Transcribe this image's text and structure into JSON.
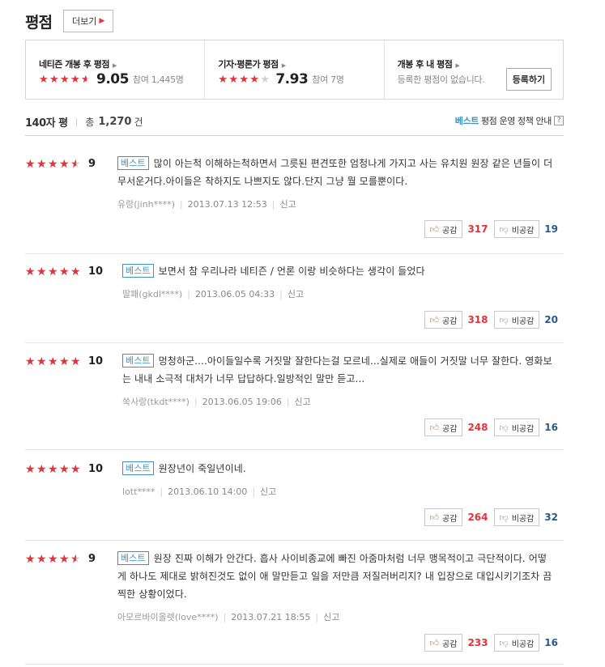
{
  "header": {
    "title": "평점",
    "more_label": "더보기"
  },
  "summary_box": {
    "netizen": {
      "label": "네티즌 개봉 후 평점",
      "rating": 9.05,
      "score": "9.05",
      "participants": "참여 1,445명"
    },
    "critic": {
      "label": "기자·평론가 평점",
      "rating": 7.93,
      "score": "7.93",
      "participants": "참여 7명"
    },
    "mine": {
      "label": "개봉 후 내 평점",
      "none_text": "등록한 평점이 없습니다.",
      "register_label": "등록하기"
    }
  },
  "summary": {
    "title": "140자 평",
    "total_label": "총",
    "total_count": "1,270",
    "total_unit": "건",
    "policy_best": "베스트",
    "policy_text": "평점 운영 정책 안내",
    "help_label": "?"
  },
  "badge_label": "베스트",
  "vote_labels": {
    "like": "공감",
    "dislike": "비공감"
  },
  "report_label": "신고",
  "reviews": [
    {
      "rating": 9,
      "score": "9",
      "text": "많이 아는척 이해하는척하면서 그릇된 편견또한 엄청나게 가지고 사는 유치원 원장 같은 년들이 더 무서운거다.아이들은 착하지도 나쁘지도 않다.단지 그냥 뭘 모를뿐이다.",
      "author": "유랑(jinh****)",
      "date": "2013.07.13 12:53",
      "likes": "317",
      "dislikes": "19"
    },
    {
      "rating": 10,
      "score": "10",
      "text": "보면서 참 우리나라 네티즌 / 언론 이랑 비슷하다는 생각이 들었다",
      "author": "딸패(gkdl****)",
      "date": "2013.06.05 04:33",
      "likes": "318",
      "dislikes": "20"
    },
    {
      "rating": 10,
      "score": "10",
      "text": "멍청하군....아이들일수록 거짓말 잘한다는걸 모르네...실제로 애들이 거짓말 너무 잘한다. 영화보는 내내 소극적 대처가 너무 답답하다.일방적인 말만 듣고...",
      "author": "쑥사랑(tkdt****)",
      "date": "2013.06.05 19:06",
      "likes": "248",
      "dislikes": "16"
    },
    {
      "rating": 10,
      "score": "10",
      "text": "원장년이 죽일년이네.",
      "author": "lott****",
      "date": "2013.06.10 14:00",
      "likes": "264",
      "dislikes": "32"
    },
    {
      "rating": 9,
      "score": "9",
      "text": "원장 진짜 이해가 안간다. 흡사 사이비종교에 빠진 아줌마처럼 너무 맹목적이고 극단적이다. 어떻게 하나도 제대로 밝혀진것도 없이 애 말만듣고 일을 저만큼 저질러버리지? 내 입장으로 대입시키기조차 끔찍한 상황이었다.",
      "author": "아모르바이올렛(love****)",
      "date": "2013.07.21 18:55",
      "likes": "233",
      "dislikes": "16"
    }
  ],
  "colors": {
    "star": "#e2343a",
    "best": "#3a95c5",
    "likes": "#e2343a",
    "dislikes": "#2b5a8a"
  }
}
